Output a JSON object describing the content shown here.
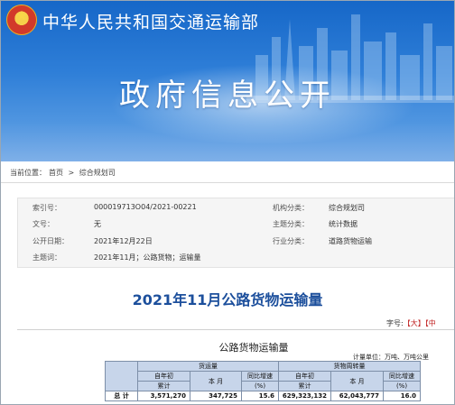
{
  "header": {
    "site_title": "中华人民共和国交通运输部",
    "section_title": "政府信息公开"
  },
  "breadcrumb": {
    "prefix": "当前位置：",
    "home": "首页",
    "separator": ">",
    "current": "综合规划司"
  },
  "meta": {
    "index_label": "索引号：",
    "index_value": "000019713O04/2021-00221",
    "org_label": "机构分类：",
    "org_value": "综合规划司",
    "doc_label": "文号：",
    "doc_value": "无",
    "topic_label": "主题分类：",
    "topic_value": "统计数据",
    "date_label": "公开日期：",
    "date_value": "2021年12月22日",
    "industry_label": "行业分类：",
    "industry_value": "道路货物运输",
    "keywords_label": "主题词：",
    "keywords_value": "2021年11月；公路货物；运输量"
  },
  "article": {
    "title": "2021年11月公路货物运输量",
    "font_size_label": "字号:",
    "font_large": "【大】",
    "font_medium": "【中"
  },
  "table": {
    "title": "公路货物运输量",
    "unit": "计量单位：万吨、万吨公里",
    "group1": "货运量",
    "group2": "货物周转量",
    "ytd": "自年初",
    "ytd_sub": "累计",
    "month": "本 月",
    "yoy": "同比增速",
    "yoy_unit": "(%)",
    "row_label": "总  计",
    "values": [
      "3,571,270",
      "347,725",
      "15.6",
      "629,323,132",
      "62,043,777",
      "16.0"
    ]
  }
}
